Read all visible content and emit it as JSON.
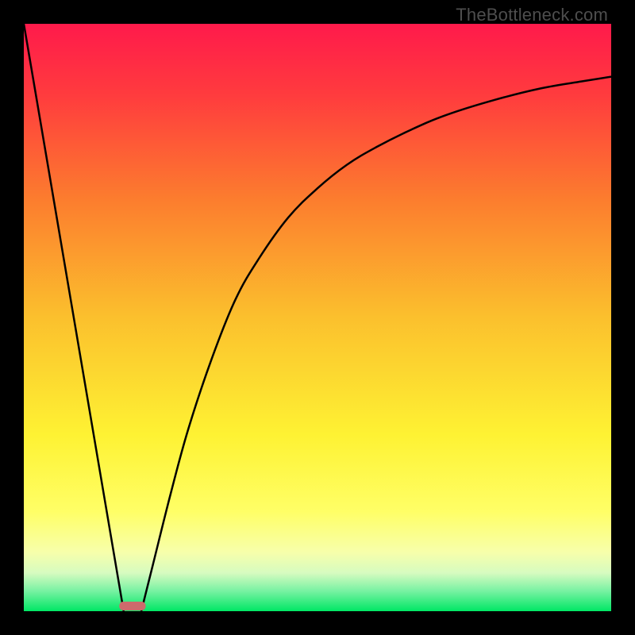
{
  "watermark": "TheBottleneck.com",
  "chart_data": {
    "type": "line",
    "title": "",
    "xlabel": "",
    "ylabel": "",
    "xlim": [
      0,
      100
    ],
    "ylim": [
      0,
      100
    ],
    "grid": false,
    "legend": false,
    "background_gradient": {
      "stops": [
        {
          "pos": 0.0,
          "color": "#ff1a4b"
        },
        {
          "pos": 0.12,
          "color": "#ff3b3e"
        },
        {
          "pos": 0.3,
          "color": "#fc7d2e"
        },
        {
          "pos": 0.5,
          "color": "#fbc02d"
        },
        {
          "pos": 0.7,
          "color": "#fef233"
        },
        {
          "pos": 0.83,
          "color": "#ffff66"
        },
        {
          "pos": 0.9,
          "color": "#f7ffab"
        },
        {
          "pos": 0.935,
          "color": "#d6fbc0"
        },
        {
          "pos": 0.965,
          "color": "#7af2a3"
        },
        {
          "pos": 1.0,
          "color": "#00e765"
        }
      ]
    },
    "series": [
      {
        "name": "left-line",
        "x": [
          0,
          17
        ],
        "y": [
          100,
          0
        ]
      },
      {
        "name": "right-curve",
        "x": [
          20,
          22,
          25,
          28,
          32,
          36,
          40,
          45,
          50,
          55,
          60,
          66,
          72,
          80,
          88,
          95,
          100
        ],
        "y": [
          0,
          8,
          20,
          31,
          43,
          53,
          60,
          67,
          72,
          76,
          79,
          82,
          84.5,
          87,
          89,
          90.2,
          91
        ]
      }
    ],
    "marker": {
      "name": "bottleneck-marker",
      "x_center": 18.5,
      "width_pct": 4.5,
      "color": "#cd6a6c"
    }
  }
}
